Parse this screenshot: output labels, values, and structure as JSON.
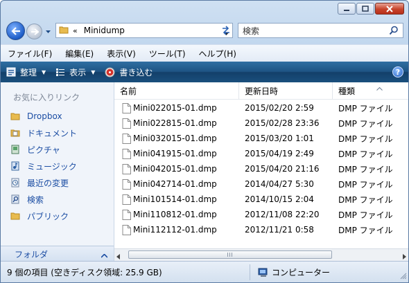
{
  "window": {
    "path_chevron": "«",
    "path": "Minidump",
    "search_placeholder": "検索"
  },
  "menubar": [
    {
      "label": "ファイル(F)"
    },
    {
      "label": "編集(E)"
    },
    {
      "label": "表示(V)"
    },
    {
      "label": "ツール(T)"
    },
    {
      "label": "ヘルプ(H)"
    }
  ],
  "command_bar": {
    "organize": "整理",
    "views": "表示",
    "burn": "書き込む",
    "help": "?"
  },
  "nav_pane": {
    "title": "お気に入りリンク",
    "items": [
      {
        "label": "Dropbox",
        "icon": "folder-icon"
      },
      {
        "label": "ドキュメント",
        "icon": "documents-icon"
      },
      {
        "label": "ピクチャ",
        "icon": "pictures-icon"
      },
      {
        "label": "ミュージック",
        "icon": "music-icon"
      },
      {
        "label": "最近の変更",
        "icon": "recent-changes-icon"
      },
      {
        "label": "検索",
        "icon": "search-folder-icon"
      },
      {
        "label": "パブリック",
        "icon": "public-folder-icon"
      }
    ],
    "folders_label": "フォルダ"
  },
  "file_list": {
    "columns": [
      {
        "label": "名前"
      },
      {
        "label": "更新日時"
      },
      {
        "label": "種類"
      }
    ],
    "rows": [
      {
        "name": "Mini022015-01.dmp",
        "modified": "2015/02/20 2:59",
        "type": "DMP ファイル"
      },
      {
        "name": "Mini022815-01.dmp",
        "modified": "2015/02/28 23:36",
        "type": "DMP ファイル"
      },
      {
        "name": "Mini032015-01.dmp",
        "modified": "2015/03/20 1:01",
        "type": "DMP ファイル"
      },
      {
        "name": "Mini041915-01.dmp",
        "modified": "2015/04/19 2:49",
        "type": "DMP ファイル"
      },
      {
        "name": "Mini042015-01.dmp",
        "modified": "2015/04/20 21:16",
        "type": "DMP ファイル"
      },
      {
        "name": "Mini042714-01.dmp",
        "modified": "2014/04/27 5:30",
        "type": "DMP ファイル"
      },
      {
        "name": "Mini101514-01.dmp",
        "modified": "2014/10/15 2:04",
        "type": "DMP ファイル"
      },
      {
        "name": "Mini110812-01.dmp",
        "modified": "2012/11/08 22:20",
        "type": "DMP ファイル"
      },
      {
        "name": "Mini112112-01.dmp",
        "modified": "2012/11/21 0:58",
        "type": "DMP ファイル"
      }
    ]
  },
  "status_bar": {
    "item_count": "9 個の項目 (空きディスク領域: 25.9 GB)",
    "location": "コンピューター"
  }
}
